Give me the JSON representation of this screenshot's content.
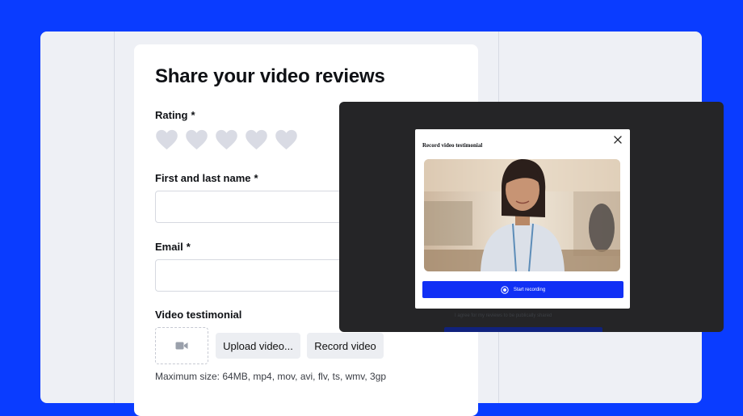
{
  "form": {
    "title": "Share your video reviews",
    "rating_label": "Rating",
    "required_mark": "*",
    "name_label": "First and last name",
    "email_label": "Email",
    "video_label": "Video testimonial",
    "upload_label": "Upload video...",
    "record_label": "Record video",
    "hint": "Maximum size: 64MB, mp4, mov, avi, flv, ts, wmv, 3gp",
    "rating_value": 0,
    "rating_max": 5
  },
  "modal": {
    "title": "Record video testimonial",
    "start_label": "Start recording"
  },
  "background": {
    "consent_text": "I agree for my reviews to be publically shared"
  },
  "icons": {
    "star": "heart-icon",
    "dropzone": "video-camera-icon",
    "close": "close-icon",
    "record": "record-icon"
  },
  "colors": {
    "page_bg": "#0a3cff",
    "heart_empty": "#d9dbe4",
    "accent": "#1130f5",
    "overlay": "#252527"
  }
}
